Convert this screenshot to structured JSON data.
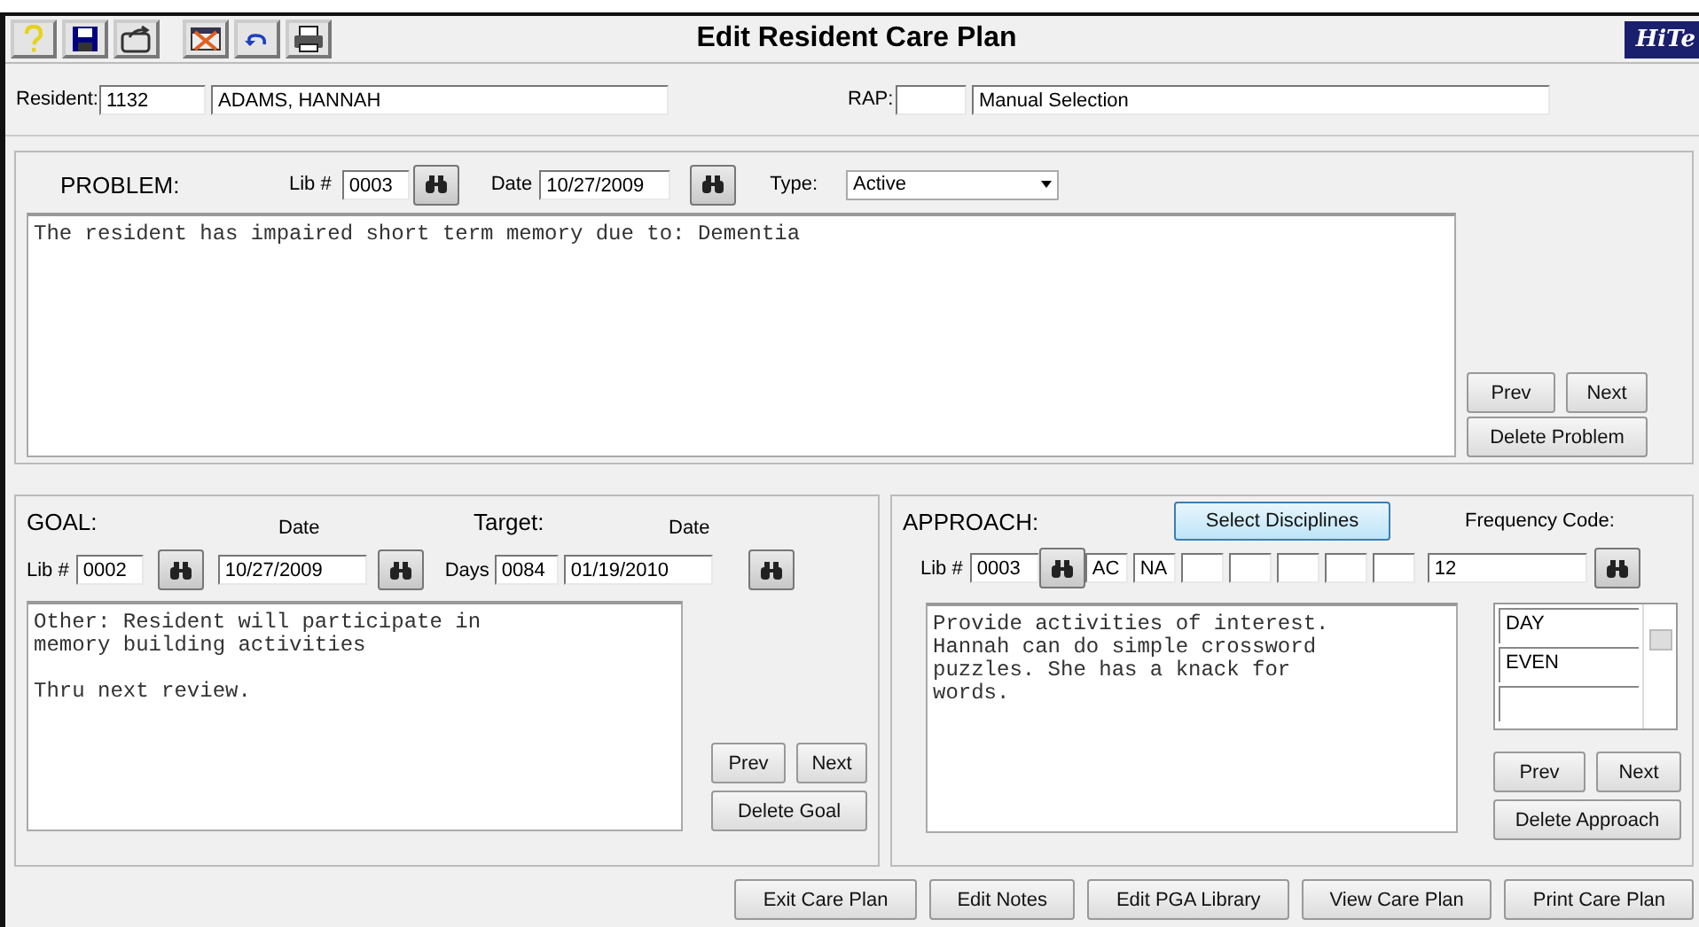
{
  "window": {
    "title": "Edit Resident Care Plan",
    "logo": "HiTe"
  },
  "resident": {
    "label": "Resident:",
    "id": "1132",
    "name": "ADAMS, HANNAH",
    "rap_label": "RAP:",
    "rap_selection": "Manual Selection"
  },
  "problem": {
    "heading": "PROBLEM:",
    "lib_label": "Lib #",
    "lib": "0003",
    "date_label": "Date",
    "date": "10/27/2009",
    "type_label": "Type:",
    "type": "Active",
    "text": "The resident has impaired short term memory due to: Dementia",
    "buttons": [
      "Prev",
      "Next",
      "Delete Problem"
    ]
  },
  "goal": {
    "heading": "GOAL:",
    "date_heading": "Date",
    "target_heading": "Target:",
    "target_date_heading": "Date",
    "lib_label": "Lib #",
    "lib": "0002",
    "date": "10/27/2009",
    "days_label": "Days",
    "days": "0084",
    "target_date": "01/19/2010",
    "text": "Other: Resident will participate in\nmemory building activities\n\nThru next review.",
    "buttons": [
      "Prev",
      "Next",
      "Delete Goal"
    ]
  },
  "approach": {
    "heading": "APPROACH:",
    "select_button": "Select Disciplines",
    "lib_label": "Lib #",
    "lib": "0003",
    "disciplines": [
      "AC",
      "NA"
    ],
    "text": "Provide activities of interest.\nHannah can do simple crossword\npuzzles. She has a knack for\nwords.",
    "frequency_label": "Frequency Code:",
    "frequency": "12",
    "frequency_items": [
      "DAY",
      "EVEN"
    ],
    "buttons": [
      "Prev",
      "Next",
      "Delete Approach"
    ]
  },
  "footer_buttons": [
    "Exit Care Plan",
    "Edit Notes",
    "Edit PGA Library",
    "View Care Plan",
    "Print Care Plan"
  ]
}
